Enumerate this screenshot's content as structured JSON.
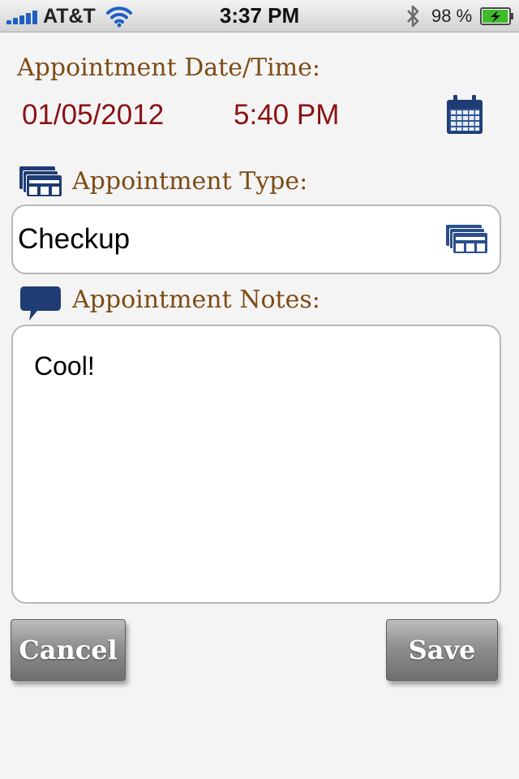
{
  "status_bar": {
    "carrier": "AT&T",
    "time": "3:37 PM",
    "battery_percent": "98 %",
    "signal_bars": 5,
    "battery_level": 0.98,
    "battery_color": "#3dbb2b"
  },
  "appointment": {
    "datetime_label": "Appointment Date/Time:",
    "date": "01/05/2012",
    "time": "5:40 PM",
    "type_label": "Appointment Type:",
    "type_value": "Checkup",
    "notes_label": "Appointment Notes:",
    "notes_value": "Cool!"
  },
  "buttons": {
    "cancel_label": "Cancel",
    "save_label": "Save"
  },
  "colors": {
    "label_brown": "#7e4b14",
    "value_red": "#8a1212",
    "icon_navy": "#1f3d74"
  },
  "icons": {
    "calendar": "calendar-icon",
    "type": "list-icon",
    "notes": "speech-bubble-icon"
  }
}
